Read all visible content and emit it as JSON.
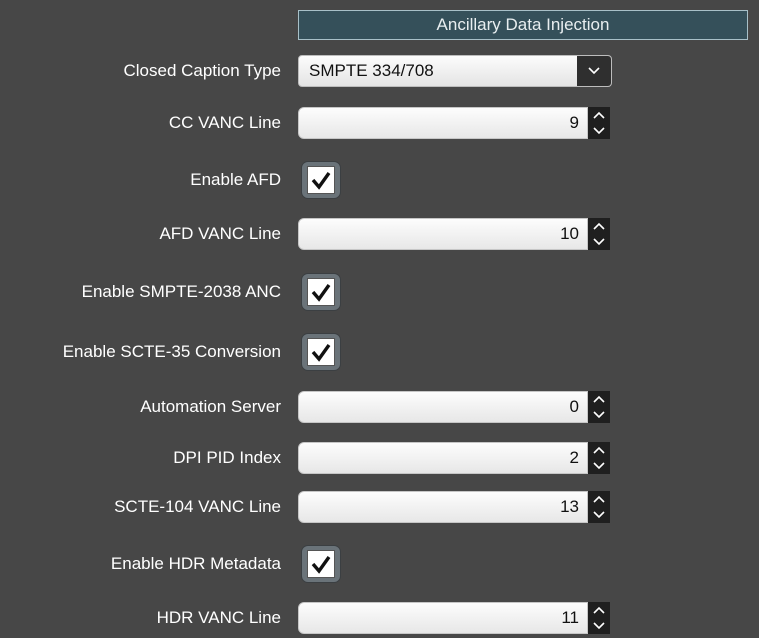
{
  "section_title": "Ancillary Data Injection",
  "closed_caption": {
    "label": "Closed Caption Type",
    "value": "SMPTE 334/708"
  },
  "cc_vanc": {
    "label": "CC VANC Line",
    "value": "9"
  },
  "enable_afd": {
    "label": "Enable AFD",
    "checked": true
  },
  "afd_vanc": {
    "label": "AFD VANC Line",
    "value": "10"
  },
  "enable_smpte2038": {
    "label": "Enable SMPTE-2038 ANC",
    "checked": true
  },
  "enable_scte35": {
    "label": "Enable SCTE-35 Conversion",
    "checked": true
  },
  "automation_server": {
    "label": "Automation Server",
    "value": "0"
  },
  "dpi_pid": {
    "label": "DPI PID Index",
    "value": "2"
  },
  "scte104_vanc": {
    "label": "SCTE-104 VANC Line",
    "value": "13"
  },
  "enable_hdr": {
    "label": "Enable HDR Metadata",
    "checked": true
  },
  "hdr_vanc": {
    "label": "HDR VANC Line",
    "value": "11"
  },
  "icons": {
    "dropdown": "chevron-down-icon",
    "spin_up": "chevron-up-icon",
    "spin_down": "chevron-down-icon",
    "check": "checkmark-icon"
  },
  "colors": {
    "background": "#474747",
    "header_bg": "#35505a",
    "header_border": "#a8c0c8",
    "checkbox_frame": "#6a7379"
  }
}
